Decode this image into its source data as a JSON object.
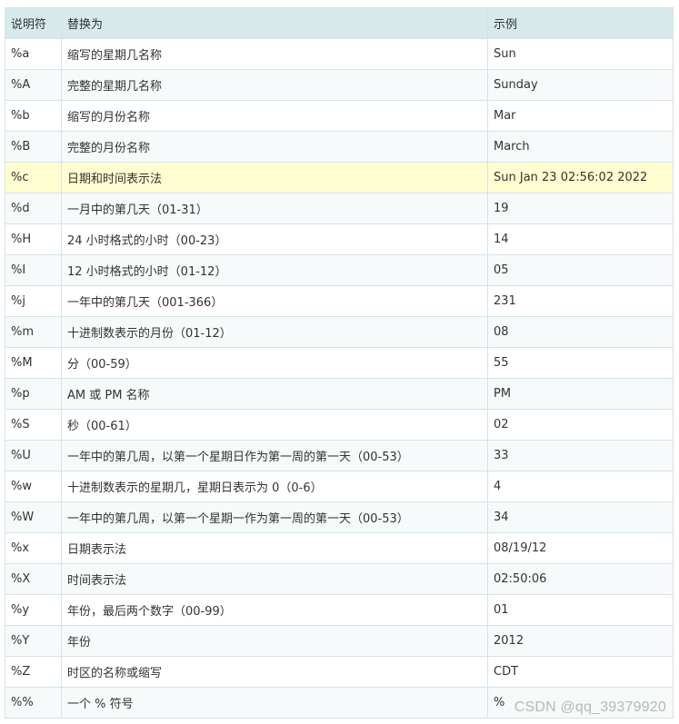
{
  "table": {
    "headers": [
      "说明符",
      "替换为",
      "示例"
    ],
    "rows": [
      {
        "spec": "%a",
        "desc": "缩写的星期几名称",
        "example": "Sun"
      },
      {
        "spec": "%A",
        "desc": "完整的星期几名称",
        "example": "Sunday"
      },
      {
        "spec": "%b",
        "desc": "缩写的月份名称",
        "example": "Mar"
      },
      {
        "spec": "%B",
        "desc": "完整的月份名称",
        "example": "March"
      },
      {
        "spec": "%c",
        "desc": "日期和时间表示法",
        "example": "Sun Jan 23 02:56:02 2022"
      },
      {
        "spec": "%d",
        "desc": "一月中的第几天（01-31）",
        "example": "19"
      },
      {
        "spec": "%H",
        "desc": "24 小时格式的小时（00-23）",
        "example": "14"
      },
      {
        "spec": "%I",
        "desc": "12 小时格式的小时（01-12）",
        "example": "05"
      },
      {
        "spec": "%j",
        "desc": "一年中的第几天（001-366）",
        "example": "231"
      },
      {
        "spec": "%m",
        "desc": "十进制数表示的月份（01-12）",
        "example": "08"
      },
      {
        "spec": "%M",
        "desc": "分（00-59）",
        "example": "55"
      },
      {
        "spec": "%p",
        "desc": "AM 或 PM 名称",
        "example": "PM"
      },
      {
        "spec": "%S",
        "desc": "秒（00-61）",
        "example": "02"
      },
      {
        "spec": "%U",
        "desc": "一年中的第几周，以第一个星期日作为第一周的第一天（00-53）",
        "example": "33"
      },
      {
        "spec": "%w",
        "desc": "十进制数表示的星期几，星期日表示为 0（0-6）",
        "example": "4"
      },
      {
        "spec": "%W",
        "desc": "一年中的第几周，以第一个星期一作为第一周的第一天（00-53）",
        "example": "34"
      },
      {
        "spec": "%x",
        "desc": "日期表示法",
        "example": "08/19/12"
      },
      {
        "spec": "%X",
        "desc": "时间表示法",
        "example": "02:50:06"
      },
      {
        "spec": "%y",
        "desc": "年份，最后两个数字（00-99）",
        "example": "01"
      },
      {
        "spec": "%Y",
        "desc": "年份",
        "example": "2012"
      },
      {
        "spec": "%Z",
        "desc": "时区的名称或缩写",
        "example": "CDT"
      },
      {
        "spec": "%%",
        "desc": "一个 % 符号",
        "example": "%"
      }
    ]
  },
  "highlight_color": "#fffed0",
  "header_color": "#d6eaec",
  "watermark": "CSDN @qq_39379920"
}
